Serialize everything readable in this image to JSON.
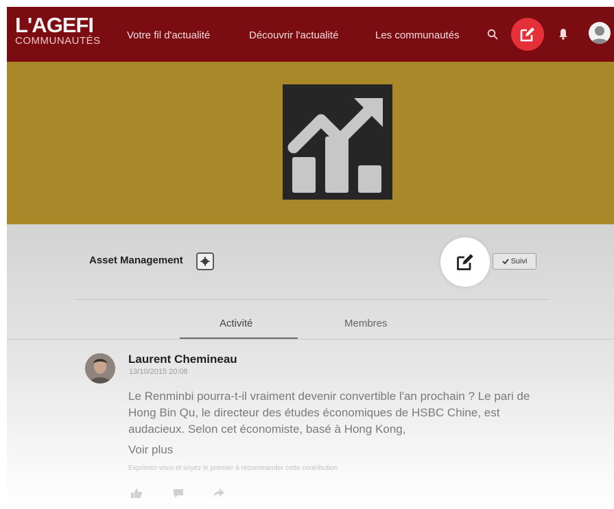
{
  "brand": {
    "name": "L'AGEFI",
    "sub": "COMMUNAUTÉS"
  },
  "nav": {
    "links": [
      "Votre fil d'actualité",
      "Découvrir l'actualité",
      "Les communautés"
    ]
  },
  "community": {
    "title": "Asset Management",
    "follow_label": "Suivi"
  },
  "tabs": [
    "Activité",
    "Membres"
  ],
  "post": {
    "author": "Laurent Chemineau",
    "date": "13/10/2015 20:08",
    "body": "Le Renminbi pourra-t-il vraiment devenir convertible l'an prochain ? Le pari de Hong Bin Qu, le directeur des études économiques de HSBC Chine, est audacieux. Selon cet économiste, basé à Hong Kong,",
    "more_label": "Voir plus",
    "hint": "Exprimez-vous et soyez le premier à recommander cette contribution"
  },
  "colors": {
    "topbar": "#7a0c12",
    "accent": "#e53039",
    "banner": "#a88829"
  },
  "icons": [
    "search-icon",
    "compose-icon",
    "bell-icon",
    "user-avatar-icon",
    "trend-chart-icon",
    "gear-icon",
    "check-icon",
    "like-icon",
    "comment-icon",
    "share-icon"
  ]
}
